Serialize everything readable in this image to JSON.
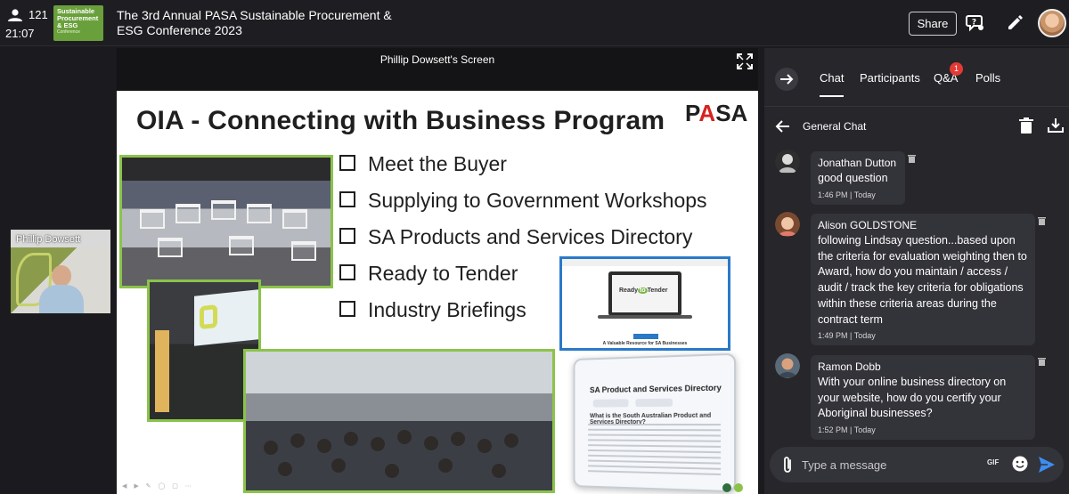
{
  "header": {
    "attendee_count": "121",
    "clock": "21:07",
    "logo_lines": [
      "Sustainable",
      "Procurement",
      "& ESG",
      "Conference"
    ],
    "event_title": "The 3rd Annual PASA Sustainable Procurement & ESG Conference 2023",
    "share_label": "Share",
    "icons": [
      "person-icon",
      "help-icon",
      "pencil-icon",
      "profile-avatar"
    ]
  },
  "participant_tile": {
    "name": "Phillip Dowsett"
  },
  "screen_share": {
    "label": "Phillip Dowsett's Screen",
    "slide": {
      "title": "OIA - Connecting with Business Program",
      "brand": [
        "P",
        "A",
        "S",
        "A"
      ],
      "bullets": [
        "Meet the Buyer",
        "Supplying to Government Workshops",
        "SA Products and Services Directory",
        "Ready to Tender",
        "Industry Briefings"
      ],
      "ready_to_tender": {
        "pre": "Ready",
        "mark": "to",
        "post": "Tender",
        "caption": "A Valuable Resource for SA Businesses"
      },
      "directory": {
        "title": "SA Product and Services Directory",
        "question": "What is the South Australian Product and Services Directory?"
      },
      "dot_colors": [
        "#2f6f3e",
        "#8bc34a"
      ]
    }
  },
  "panel": {
    "tabs": [
      {
        "label": "Chat",
        "active": true
      },
      {
        "label": "Participants",
        "active": false
      },
      {
        "label": "Q&A",
        "active": false,
        "badge": "1"
      },
      {
        "label": "Polls",
        "active": false
      }
    ],
    "chat_title": "General Chat",
    "messages": [
      {
        "sender": "Jonathan Dutton",
        "text": "good question",
        "time": "1:46 PM | Today"
      },
      {
        "sender": "Alison  GOLDSTONE",
        "text": "following Lindsay question...based upon the criteria for evaluation weighting then to Award, how do you maintain / access / audit / track the key criteria for obligations within these criteria areas during the contract term",
        "time": "1:49 PM | Today"
      },
      {
        "sender": "Ramon Dobb",
        "text": "With your online business directory on your website, how do you certify your Aboriginal businesses?",
        "time": "1:52 PM | Today"
      }
    ],
    "composer": {
      "placeholder": "Type a message",
      "gif_label": "GIF"
    },
    "accent_color": "#3d8df0"
  }
}
